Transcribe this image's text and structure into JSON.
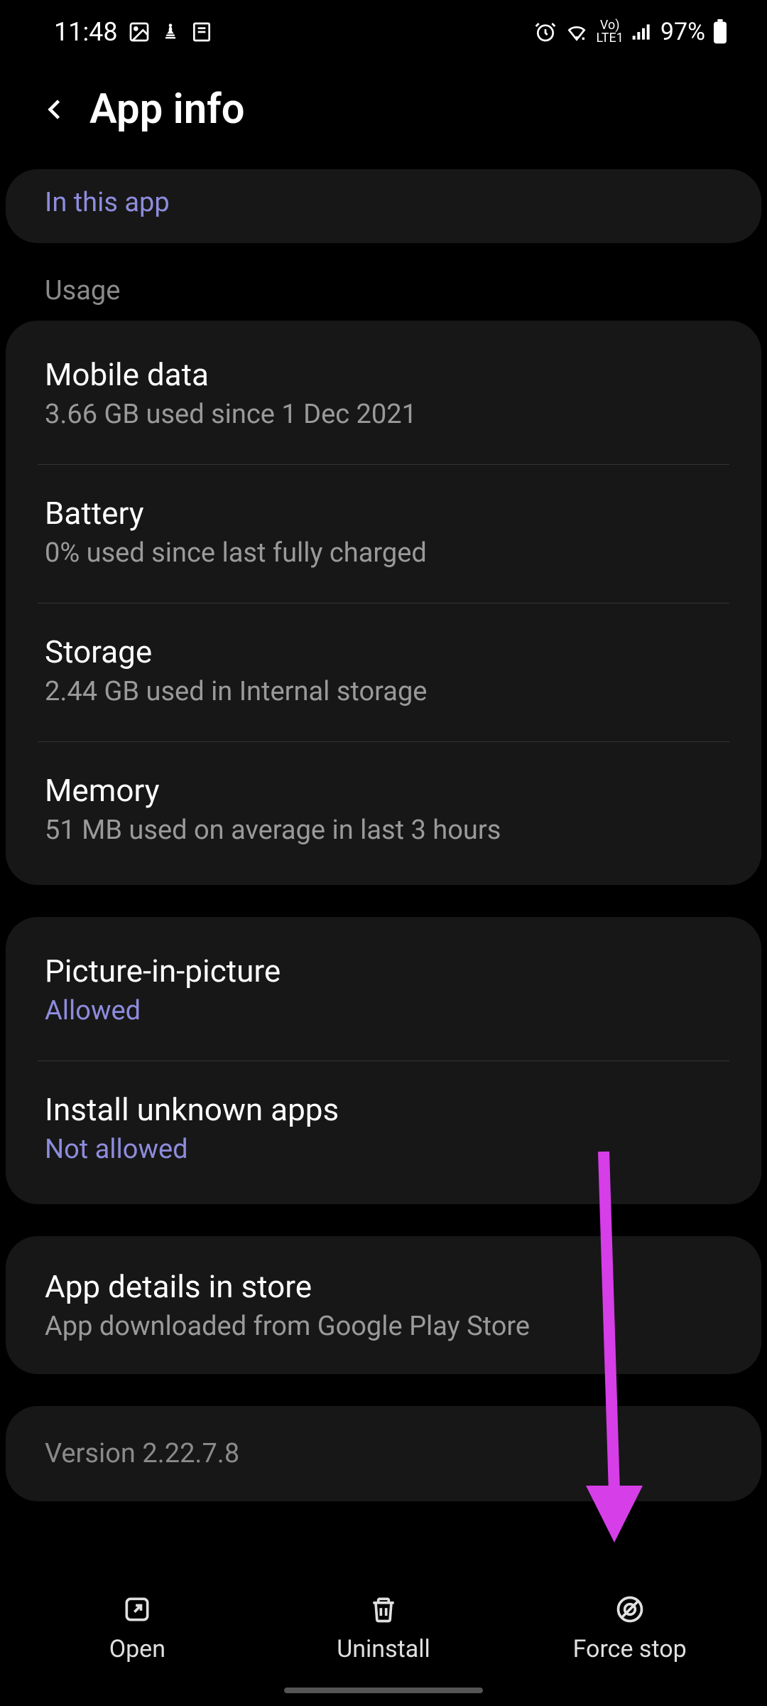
{
  "statusbar": {
    "time": "11:48",
    "battery_pct": "97%"
  },
  "header": {
    "title": "App info"
  },
  "top_card": {
    "subtitle": "In this app"
  },
  "usage": {
    "label": "Usage",
    "items": [
      {
        "title": "Mobile data",
        "subtitle": "3.66 GB used since 1 Dec 2021"
      },
      {
        "title": "Battery",
        "subtitle": "0% used since last fully charged"
      },
      {
        "title": "Storage",
        "subtitle": "2.44 GB used in Internal storage"
      },
      {
        "title": "Memory",
        "subtitle": "51 MB used on average in last 3 hours"
      }
    ]
  },
  "advanced": {
    "items": [
      {
        "title": "Picture-in-picture",
        "subtitle": "Allowed"
      },
      {
        "title": "Install unknown apps",
        "subtitle": "Not allowed"
      }
    ]
  },
  "store": {
    "title": "App details in store",
    "subtitle": "App downloaded from Google Play Store"
  },
  "version": "Version 2.22.7.8",
  "bottombar": {
    "open": "Open",
    "uninstall": "Uninstall",
    "forcestop": "Force stop"
  },
  "annotation": {
    "color": "#d63ee8"
  }
}
